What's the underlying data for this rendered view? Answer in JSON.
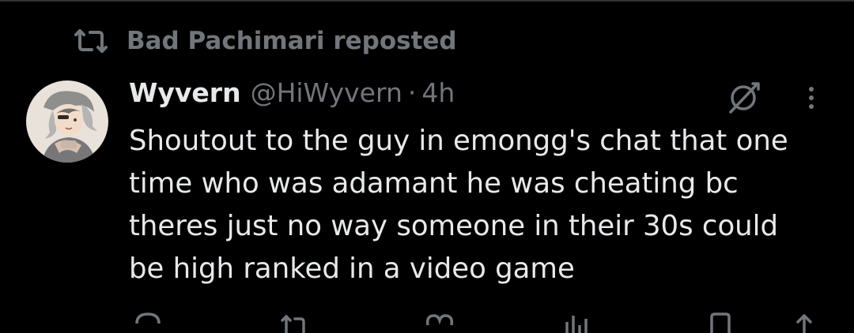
{
  "colors": {
    "background": "#000000",
    "primary_text": "#e7e9ea",
    "secondary_text": "#71767b",
    "divider": "#2f3336"
  },
  "repost": {
    "icon": "repost-icon",
    "text": "Bad Pachimari reposted"
  },
  "tweet": {
    "avatar": "avatar",
    "display_name": "Wyvern",
    "handle": "@HiWyvern",
    "separator": "·",
    "timestamp": "4h",
    "text": "Shoutout to the guy in emongg's chat that one\ntime who was adamant he was cheating bc\ntheres just no way someone in their 30s could\nbe high ranked in a video game",
    "header_icons": [
      "grok-icon",
      "more-options-icon"
    ]
  },
  "actions": {
    "icons": [
      "reply-icon",
      "repost-icon",
      "like-icon",
      "views-icon",
      "bookmark-icon",
      "share-icon"
    ]
  }
}
